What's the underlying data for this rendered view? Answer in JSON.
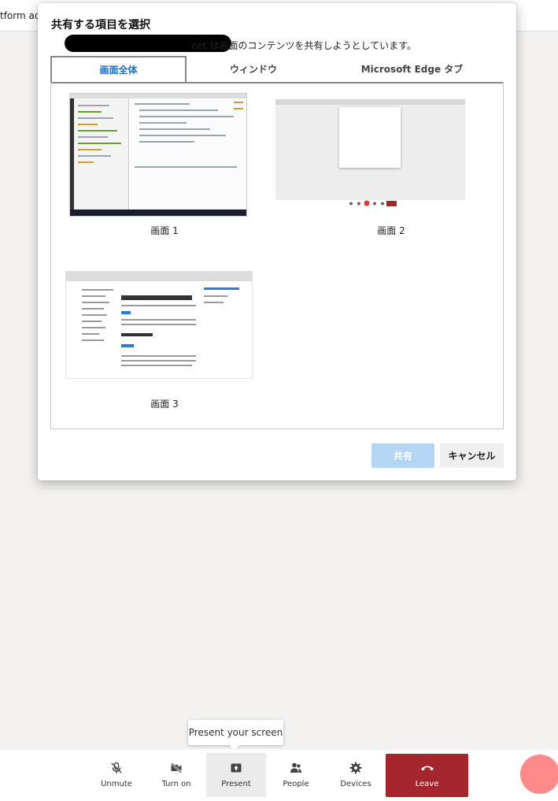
{
  "background": {
    "partial_text": "tform ad."
  },
  "dialog": {
    "title": "共有する項目を選択",
    "subtitle": "net は画面のコンテンツを共有しようとしています。",
    "tabs": [
      {
        "label": "画面全体",
        "active": true
      },
      {
        "label": "ウィンドウ",
        "active": false
      },
      {
        "label": "Microsoft Edge タブ",
        "active": false
      }
    ],
    "screens": [
      {
        "label": "画面 1"
      },
      {
        "label": "画面 2"
      },
      {
        "label": "画面 3"
      }
    ],
    "share_label": "共有",
    "cancel_label": "キャンセル"
  },
  "tooltip": {
    "text": "Present your screen"
  },
  "toolbar": {
    "items": [
      {
        "label": "Unmute",
        "icon": "mic-off-icon"
      },
      {
        "label": "Turn on",
        "icon": "camera-off-icon"
      },
      {
        "label": "Present",
        "icon": "present-icon"
      },
      {
        "label": "People",
        "icon": "people-icon"
      },
      {
        "label": "Devices",
        "icon": "gear-icon"
      }
    ],
    "leave_label": "Leave",
    "leave_icon": "phone-hangup-icon"
  },
  "colors": {
    "active_tab": "#1c6fc3",
    "share_button_disabled": "#b3d6f5",
    "leave_button": "#a4262c",
    "avatar": "#ff8a8a"
  }
}
